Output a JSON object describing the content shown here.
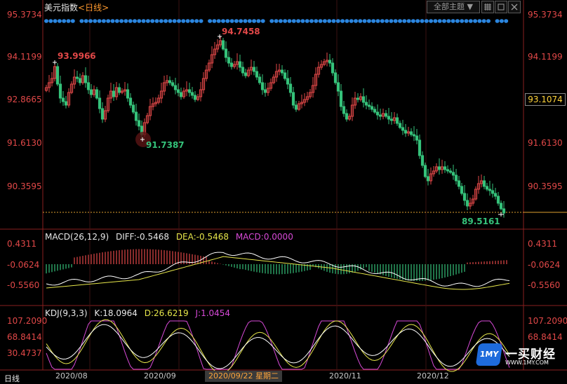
{
  "window": {
    "title": "美元指数",
    "period": "<日线>",
    "theme_button": "全部主题",
    "ctrl_icons": [
      "grid-icon",
      "restore-icon",
      "close-icon"
    ],
    "selected_price": "93.1074"
  },
  "main_axis": {
    "ticks": [
      "95.3734",
      "94.1199",
      "92.8665",
      "91.6130",
      "90.3595"
    ],
    "labels": {
      "high": "94.7458",
      "left_high": "93.9966",
      "low_mid": "91.7387",
      "last_low": "89.5161"
    }
  },
  "macd": {
    "header": {
      "name": "MACD(26,12,9)",
      "diff": "DIFF:-0.5468",
      "dea": "DEA:-0.5468",
      "macd": "MACD:0.0000"
    },
    "ticks": [
      "0.4311",
      "-0.0624",
      "-0.5560"
    ]
  },
  "kdj": {
    "header": {
      "name": "KDJ(9,3,3)",
      "k": "K:18.0964",
      "d": "D:26.6219",
      "j": "J:1.0454"
    },
    "ticks": [
      "107.2090",
      "68.8414",
      "30.4737"
    ]
  },
  "x_axis": {
    "dates": [
      "2020/08",
      "2020/09",
      "2020/11",
      "2020/12"
    ],
    "selected": "2020/09/22 星期二",
    "left_corner": "日线"
  },
  "logo": {
    "badge": "1MY",
    "main": "一买财经",
    "url": "WWW.1MY.COM"
  },
  "colors": {
    "up": "#e24848",
    "down": "#35c27a",
    "diff_line": "#ffffff",
    "dea_line": "#e6e64a",
    "j_line": "#d84ad8",
    "dots": "#2b86e0"
  }
}
